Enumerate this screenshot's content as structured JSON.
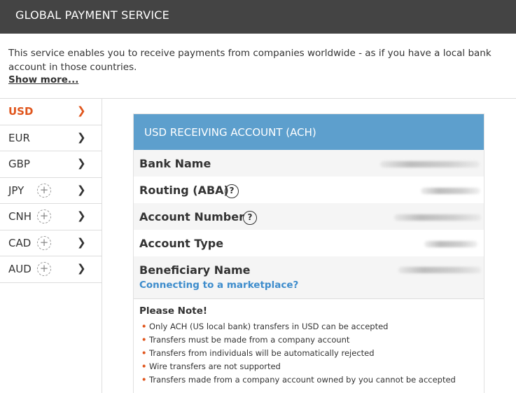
{
  "header": {
    "title": "GLOBAL PAYMENT SERVICE"
  },
  "intro": {
    "text": "This service enables you to receive payments from companies worldwide - as if you have a local bank account in those countries.",
    "show_more": "Show more..."
  },
  "currencies": [
    {
      "code": "USD",
      "active": true,
      "addable": false
    },
    {
      "code": "EUR",
      "active": false,
      "addable": false
    },
    {
      "code": "GBP",
      "active": false,
      "addable": false
    },
    {
      "code": "JPY",
      "active": false,
      "addable": true
    },
    {
      "code": "CNH",
      "active": false,
      "addable": true
    },
    {
      "code": "CAD",
      "active": false,
      "addable": true
    },
    {
      "code": "AUD",
      "active": false,
      "addable": true
    }
  ],
  "account": {
    "title": "USD RECEIVING ACCOUNT (ACH)",
    "fields": [
      {
        "label": "Bank Name"
      },
      {
        "label": "Routing (ABA)",
        "help": "?"
      },
      {
        "label": "Account Number",
        "help": "?"
      },
      {
        "label": "Account Type"
      },
      {
        "label": "Beneficiary Name"
      }
    ],
    "marketplace_link": "Connecting to a marketplace?"
  },
  "note": {
    "title": "Please Note!",
    "items": [
      "Only ACH (US local bank) transfers in USD can be accepted",
      "Transfers must be made from a company account",
      "Transfers from individuals will be automatically rejected",
      "Wire transfers are not supported",
      "Transfers made from a company account owned by you cannot be accepted"
    ]
  },
  "icons": {
    "chevron": "chevron-right-icon",
    "add": "plus-circle-icon",
    "help": "question-circle-icon"
  },
  "colors": {
    "topbar": "#444444",
    "accent": "#e0561d",
    "panel_header": "#5d9fcd",
    "link": "#3d8ccc"
  }
}
